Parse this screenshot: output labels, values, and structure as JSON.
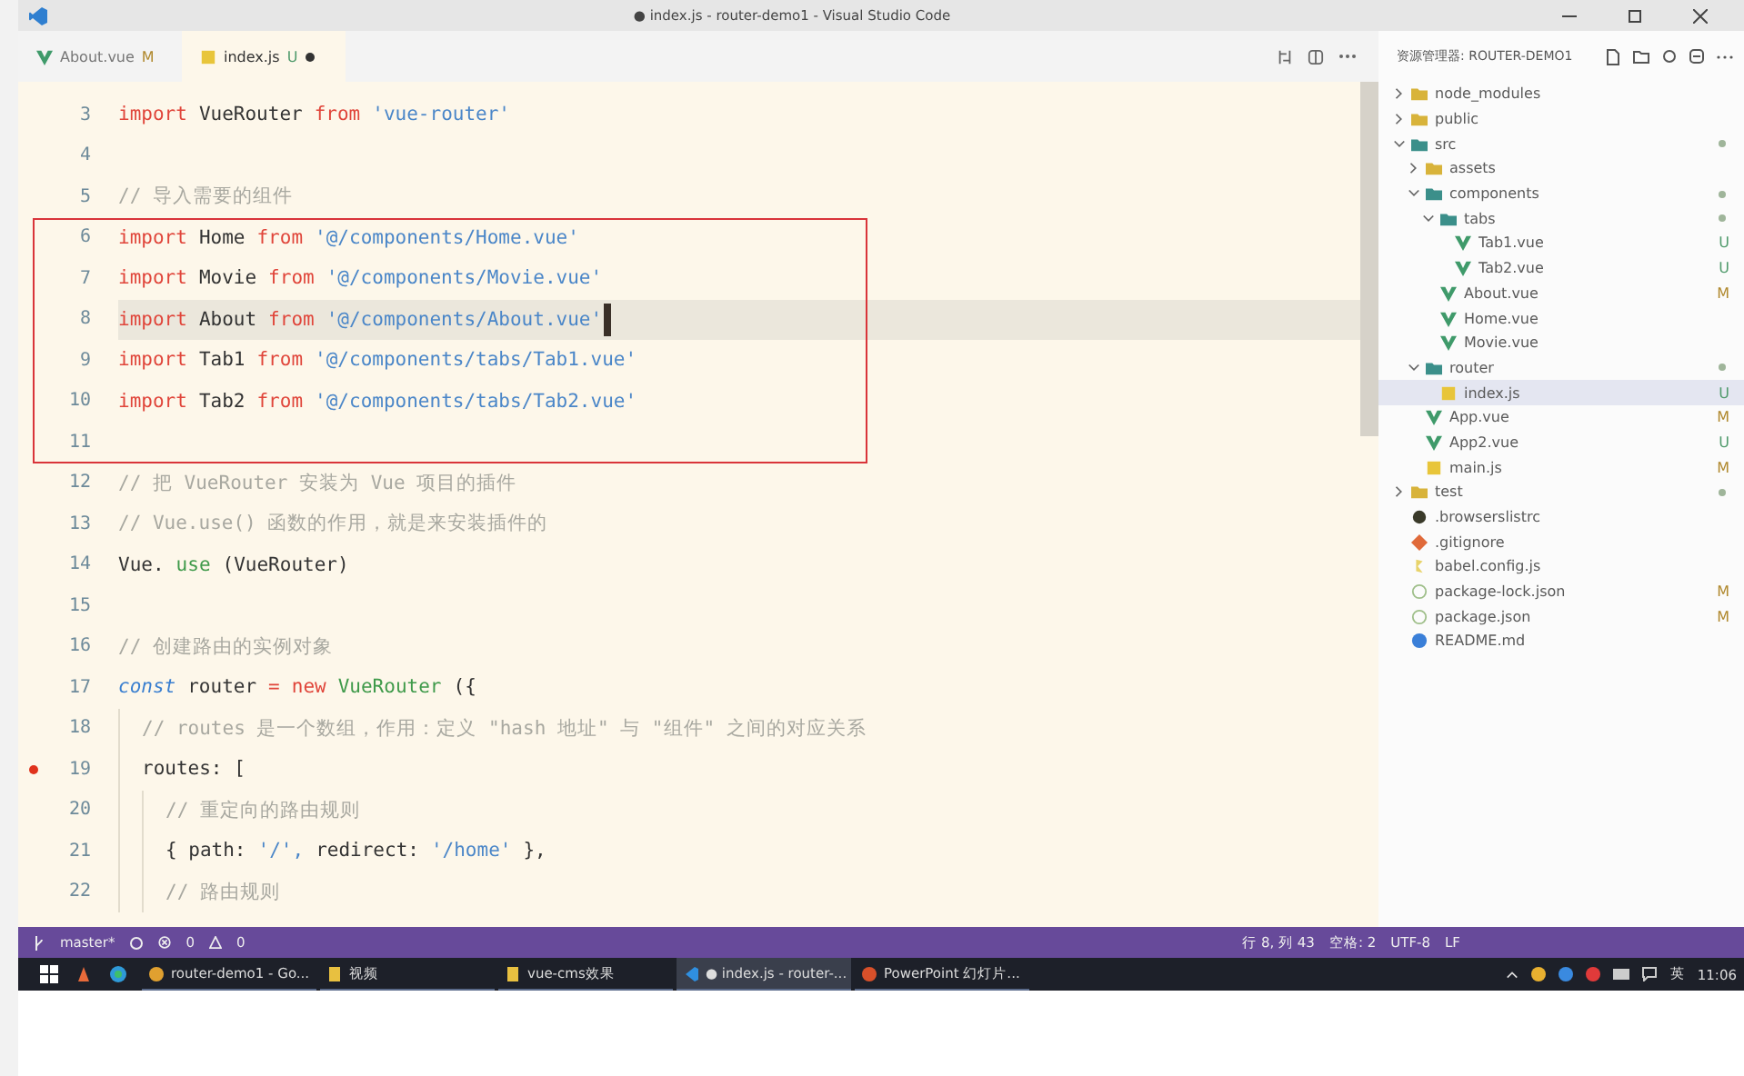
{
  "window": {
    "title": "● index.js - router-demo1 - Visual Studio Code"
  },
  "tabs": [
    {
      "label": "About.vue",
      "kind": "vue",
      "status": "M",
      "selected": false,
      "dirty": false
    },
    {
      "label": "index.js",
      "kind": "js",
      "status": "U",
      "selected": true,
      "dirty": true
    }
  ],
  "editor": {
    "lines": [
      {
        "kind": "line",
        "number": "3",
        "tokens": [
          {
            "kind": "keyword",
            "text": "import"
          },
          {
            "kind": "plain",
            "text": "VueRouter"
          },
          {
            "kind": "keyword",
            "text": "from"
          },
          {
            "kind": "string",
            "text": "'vue-router'"
          }
        ]
      },
      {
        "kind": "line",
        "number": "4"
      },
      {
        "kind": "line",
        "number": "5",
        "tokens": [
          {
            "kind": "comment",
            "text": "// 导入需要的组件"
          }
        ]
      },
      {
        "kind": "framed_group",
        "lines": [
          {
            "kind": "line",
            "number": "6",
            "tokens": [
              {
                "kind": "keyword",
                "text": "import"
              },
              {
                "kind": "plain",
                "text": "Home"
              },
              {
                "kind": "keyword",
                "text": "from"
              },
              {
                "kind": "string",
                "text": "'@/components/Home.vue'"
              }
            ]
          },
          {
            "kind": "line",
            "number": "7",
            "tokens": [
              {
                "kind": "keyword",
                "text": "import"
              },
              {
                "kind": "plain",
                "text": "Movie"
              },
              {
                "kind": "keyword",
                "text": "from"
              },
              {
                "kind": "string",
                "text": "'@/components/Movie.vue'"
              }
            ]
          },
          {
            "kind": "line",
            "number": "8",
            "current": true,
            "tokens": [
              {
                "kind": "keyword",
                "text": "import"
              },
              {
                "kind": "plain",
                "text": "About"
              },
              {
                "kind": "keyword",
                "text": "from"
              },
              {
                "kind": "string",
                "text": "'@/components/About.vue'"
              }
            ]
          },
          {
            "kind": "line",
            "number": "9",
            "tokens": [
              {
                "kind": "keyword",
                "text": "import"
              },
              {
                "kind": "plain",
                "text": "Tab1"
              },
              {
                "kind": "keyword",
                "text": "from"
              },
              {
                "kind": "string",
                "text": "'@/components/tabs/Tab1.vue'"
              }
            ]
          },
          {
            "kind": "line",
            "number": "10",
            "tokens": [
              {
                "kind": "keyword",
                "text": "import"
              },
              {
                "kind": "plain",
                "text": "Tab2"
              },
              {
                "kind": "keyword",
                "text": "from"
              },
              {
                "kind": "string",
                "text": "'@/components/tabs/Tab2.vue'"
              }
            ]
          },
          {
            "kind": "line",
            "number": "11"
          }
        ]
      },
      {
        "kind": "line",
        "number": "12",
        "tokens": [
          {
            "kind": "comment",
            "text": "// 把 VueRouter 安装为 Vue 项目的插件"
          }
        ]
      },
      {
        "kind": "line",
        "number": "13",
        "tokens": [
          {
            "kind": "comment",
            "text": "// Vue.use() 函数的作用，就是来安装插件的"
          }
        ]
      },
      {
        "kind": "line",
        "number": "14",
        "tokens": [
          {
            "kind": "plain",
            "text": "Vue."
          },
          {
            "kind": "function",
            "text": "use"
          },
          {
            "kind": "plain",
            "text": "(VueRouter)"
          }
        ]
      },
      {
        "kind": "line",
        "number": "15"
      },
      {
        "kind": "line",
        "number": "16",
        "tokens": [
          {
            "kind": "comment",
            "text": "// 创建路由的实例对象"
          }
        ]
      },
      {
        "kind": "line",
        "number": "17",
        "tokens": [
          {
            "kind": "storage",
            "text": "const"
          },
          {
            "kind": "plain",
            "text": "router"
          },
          {
            "kind": "operator",
            "text": "="
          },
          {
            "kind": "keyword",
            "text": "new"
          },
          {
            "kind": "class",
            "text": "VueRouter"
          },
          {
            "kind": "plain",
            "text": "({"
          }
        ],
        "children": [
          {
            "kind": "line",
            "number": "18",
            "tokens": [
              {
                "kind": "comment",
                "text": "// routes 是一个数组，作用：定义 \"hash 地址\" 与 \"组件\" 之间的对应关系"
              }
            ]
          },
          {
            "kind": "line",
            "number": "19",
            "breakpoint": true,
            "tokens": [
              {
                "kind": "plain",
                "text": "routes: ["
              }
            ],
            "children": [
              {
                "kind": "line",
                "number": "20",
                "tokens": [
                  {
                    "kind": "comment",
                    "text": "// 重定向的路由规则"
                  }
                ]
              },
              {
                "kind": "line",
                "number": "21",
                "tokens": [
                  {
                    "kind": "plain",
                    "text": "{ path:"
                  },
                  {
                    "kind": "string",
                    "text": "'/',"
                  },
                  {
                    "kind": "plain",
                    "text": "redirect:"
                  },
                  {
                    "kind": "string",
                    "text": "'/home'"
                  },
                  {
                    "kind": "plain",
                    "text": "},"
                  }
                ]
              },
              {
                "kind": "line",
                "number": "22",
                "tokens": [
                  {
                    "kind": "comment",
                    "text": "// 路由规则"
                  }
                ]
              }
            ]
          }
        ]
      }
    ]
  },
  "explorer": {
    "title": "资源管理器: ROUTER-DEMO1",
    "items": [
      {
        "label": "node_modules",
        "kind": "folder",
        "expanded": false,
        "selected": false
      },
      {
        "label": "public",
        "kind": "folder",
        "expanded": false,
        "selected": false
      },
      {
        "label": "src",
        "kind": "folder",
        "expanded": true,
        "selected": false,
        "dot": true,
        "children": [
          {
            "label": "assets",
            "kind": "folder",
            "expanded": false,
            "selected": false
          },
          {
            "label": "components",
            "kind": "folder",
            "expanded": true,
            "selected": false,
            "dot": true,
            "children": [
              {
                "label": "tabs",
                "kind": "folder",
                "expanded": true,
                "selected": false,
                "dot": true,
                "children": [
                  {
                    "label": "Tab1.vue",
                    "kind": "vue",
                    "selected": false,
                    "status": "U"
                  },
                  {
                    "label": "Tab2.vue",
                    "kind": "vue",
                    "selected": false,
                    "status": "U"
                  }
                ]
              },
              {
                "label": "About.vue",
                "kind": "vue",
                "selected": false,
                "status": "M"
              },
              {
                "label": "Home.vue",
                "kind": "vue",
                "selected": false
              },
              {
                "label": "Movie.vue",
                "kind": "vue",
                "selected": false
              }
            ]
          },
          {
            "label": "router",
            "kind": "folder",
            "expanded": true,
            "selected": false,
            "dot": true,
            "children": [
              {
                "label": "index.js",
                "kind": "js",
                "selected": true,
                "status": "U"
              }
            ]
          },
          {
            "label": "App.vue",
            "kind": "vue",
            "selected": false,
            "status": "M"
          },
          {
            "label": "App2.vue",
            "kind": "vue",
            "selected": false,
            "status": "U"
          },
          {
            "label": "main.js",
            "kind": "js",
            "selected": false,
            "status": "M"
          }
        ]
      },
      {
        "label": "test",
        "kind": "folder",
        "expanded": false,
        "selected": false,
        "dot": true
      },
      {
        "label": ".browserslistrc",
        "kind": "config",
        "selected": false
      },
      {
        "label": ".gitignore",
        "kind": "git",
        "selected": false
      },
      {
        "label": "babel.config.js",
        "kind": "babel",
        "selected": false
      },
      {
        "label": "package-lock.json",
        "kind": "json",
        "selected": false,
        "status": "M"
      },
      {
        "label": "package.json",
        "kind": "json",
        "selected": false,
        "status": "M"
      },
      {
        "label": "README.md",
        "kind": "info",
        "selected": false
      }
    ]
  },
  "status_bar": {
    "branch": "master*",
    "errors": "0",
    "warnings": "0",
    "items": [
      "行 8, 列 43",
      "空格: 2",
      "UTF-8",
      "LF"
    ]
  },
  "taskbar": {
    "windows": [
      {
        "label": "router-demo1 - Go...",
        "kind": "browser",
        "selected": false
      },
      {
        "label": "视频",
        "kind": "folder",
        "selected": false
      },
      {
        "label": "vue-cms效果",
        "kind": "folder",
        "selected": false
      },
      {
        "label": "● index.js - router-...",
        "kind": "code",
        "selected": true
      },
      {
        "label": "PowerPoint 幻灯片...",
        "kind": "slides",
        "selected": false
      }
    ],
    "language": "英",
    "time": "11:06"
  }
}
